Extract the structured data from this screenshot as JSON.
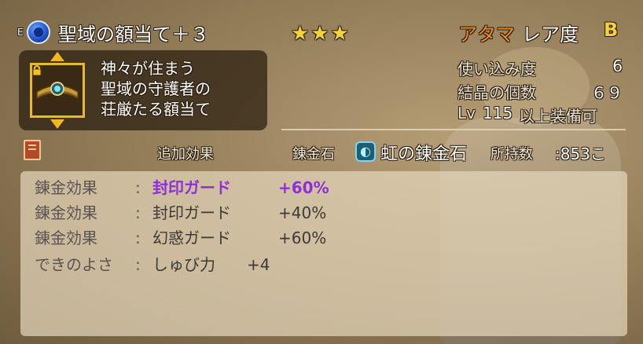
{
  "header": {
    "equip_marker": "E",
    "item_name": "聖域の額当て＋３",
    "stars": "★★★",
    "slot_type": "アタマ",
    "rarity_label": "レア度",
    "rarity_value": "B"
  },
  "description": {
    "lines": [
      "神々が住まう",
      "聖域の守護者の",
      "荘厳たる額当て"
    ]
  },
  "stats": {
    "usage_label": "使い込み度",
    "usage_value": "6",
    "crystal_label": "結晶の個数",
    "crystal_value": "６９",
    "level_prefix": "Lv",
    "level_value": "115",
    "level_suffix": "以上装備可"
  },
  "alchemy_bar": {
    "additional_effect_label": "追加効果",
    "stone_label": "錬金石",
    "stone_name": "虹の錬金石",
    "owned_label": "所持数",
    "owned_value": ":853こ"
  },
  "effects": [
    {
      "label": "錬金効果",
      "colon": ":",
      "name": "封印ガード",
      "value": "+60%",
      "highlight": true
    },
    {
      "label": "錬金効果",
      "colon": ":",
      "name": "封印ガード",
      "value": "+40%",
      "highlight": false
    },
    {
      "label": "錬金効果",
      "colon": ":",
      "name": "幻惑ガード",
      "value": "+60%",
      "highlight": false
    },
    {
      "label": "できのよさ",
      "colon": ":",
      "name": "しゅび力",
      "value": "+4",
      "highlight": false
    }
  ],
  "icons": {
    "item": "circlet-icon",
    "lock": "lock-icon",
    "book": "book-icon",
    "stone": "rainbow-stone-icon",
    "equipped": "equipped-gem-icon"
  },
  "colors": {
    "slot_type": "#f08a1a",
    "rarity": "#f4d23a",
    "stars": "#f4d23a",
    "highlight_effect": "#8e2fd8",
    "frame": "#e8b92a"
  }
}
